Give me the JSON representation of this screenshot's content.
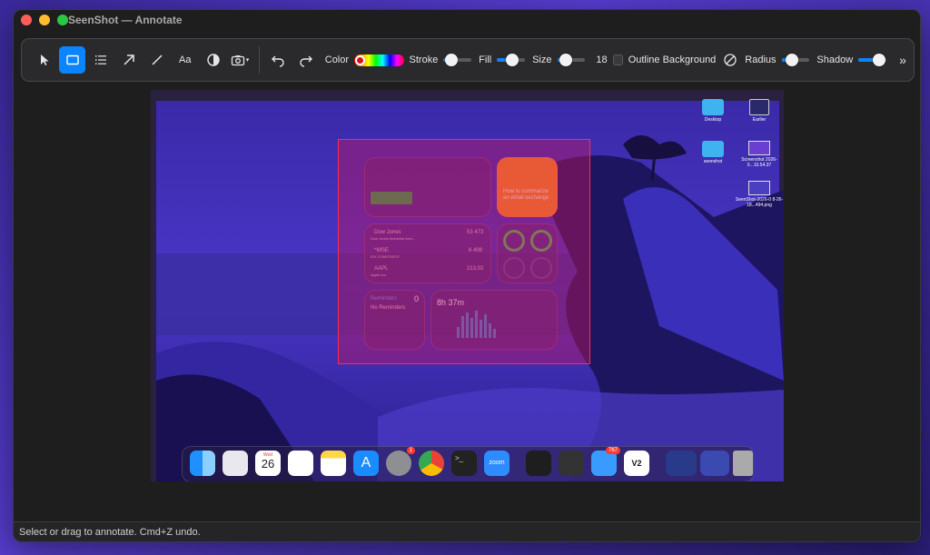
{
  "window": {
    "title": "SeenShot — Annotate"
  },
  "toolbar": {
    "tools": [
      {
        "name": "select-tool",
        "icon": "cursor-arrow-icon"
      },
      {
        "name": "rectangle-tool",
        "icon": "rectangle-icon",
        "active": true
      },
      {
        "name": "list-tool",
        "icon": "numbered-list-icon"
      },
      {
        "name": "arrow-tool",
        "icon": "arrow-up-right-icon"
      },
      {
        "name": "line-tool",
        "icon": "line-icon"
      },
      {
        "name": "text-tool",
        "icon": "text-aa-icon",
        "text": "Aa"
      },
      {
        "name": "contrast-tool",
        "icon": "contrast-icon"
      },
      {
        "name": "camera-tool",
        "icon": "camera-icon"
      }
    ],
    "color_label": "Color",
    "color_value": "#e01010",
    "stroke_label": "Stroke",
    "stroke_level": 0.1,
    "fill_label": "Fill",
    "fill_level": 0.5,
    "size_label": "Size",
    "size_level": 0.1,
    "size_value": "18",
    "outline_background_label": "Outline Background",
    "outline_background_checked": false,
    "radius_label": "Radius",
    "radius_level": 0.2,
    "shadow_label": "Shadow",
    "shadow_level": 0.8,
    "more_icon": "double-chevron-right-icon"
  },
  "screenshot": {
    "widgets": {
      "reminders_title": "Reminders",
      "reminders_count": "0",
      "reminders_empty": "No Reminders",
      "screentime_value": "8h 37m",
      "tips_text": "How to summarize an email exchange",
      "stocks": [
        {
          "symbol": "Dow Jones",
          "desc": "Dow Jones Industrial Aver...",
          "value": "53 473"
        },
        {
          "symbol": "^MSE",
          "desc": "IDX COMPOSITE",
          "value": "6 408"
        },
        {
          "symbol": "AAPL",
          "desc": "Apple Inc.",
          "value": "213,02"
        }
      ]
    },
    "desktop_icons": [
      {
        "label": "Desktop"
      },
      {
        "label": "Earlier"
      },
      {
        "label": "seenshot"
      },
      {
        "label": "Screenshot 2026-0...10.54.37"
      },
      {
        "label": "SeenShot-2026-0 8-26-18...494.png"
      }
    ],
    "dock": {
      "calendar_day": "Wed",
      "calendar_date": "26",
      "settings_badge": "1",
      "mail_badge": "767",
      "zoom_label": "zoom",
      "v2_label": "V2"
    }
  },
  "status": {
    "text": "Select or drag to annotate. Cmd+Z undo."
  },
  "colors": {
    "accent": "#0a84ff",
    "annotation": "#ff2a4a"
  }
}
